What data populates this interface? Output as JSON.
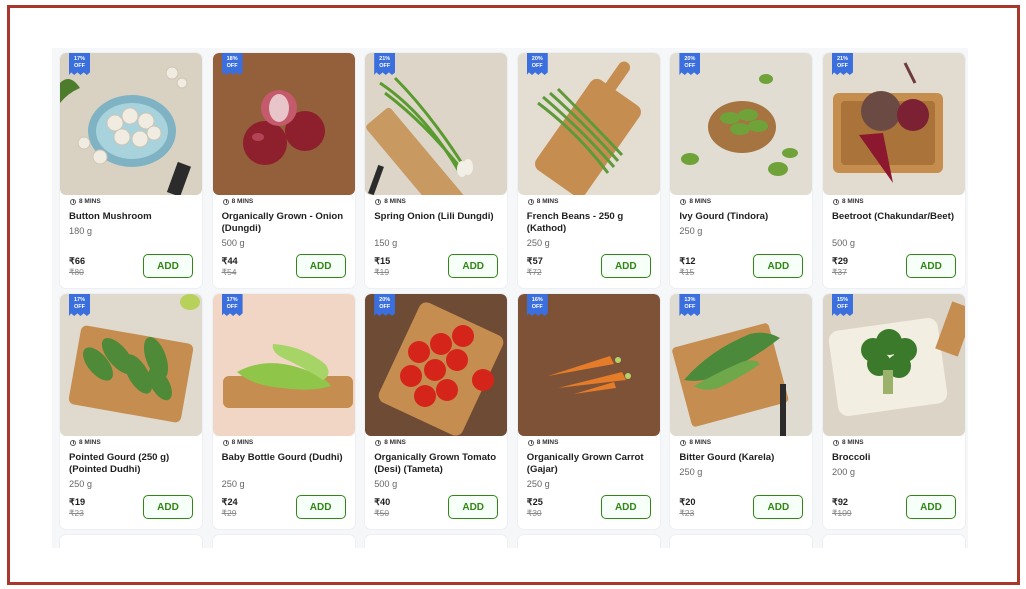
{
  "colors": {
    "frame": "#a9382c",
    "badge": "#3b6fde",
    "add_green": "#318616"
  },
  "add_label": "ADD",
  "eta_icon": "clock-icon",
  "products": [
    {
      "name": "Button Mushroom",
      "qty": "180 g",
      "price": "₹66",
      "mrp": "₹80",
      "eta": "8 MINS",
      "discount_pct": "17%",
      "off": "OFF",
      "bg": "#d9d2c3",
      "art": "mushroom"
    },
    {
      "name": "Organically Grown - Onion (Dungdi)",
      "qty": "500 g",
      "price": "₹44",
      "mrp": "₹54",
      "eta": "8 MINS",
      "discount_pct": "18%",
      "off": "OFF",
      "bg": "#93603b",
      "art": "onion"
    },
    {
      "name": "Spring Onion (Lili Dungdi)",
      "qty": "150 g",
      "price": "₹15",
      "mrp": "₹19",
      "eta": "8 MINS",
      "discount_pct": "21%",
      "off": "OFF",
      "bg": "#ddd6c8",
      "art": "springonion"
    },
    {
      "name": "French Beans - 250 g (Kathod)",
      "qty": "250 g",
      "price": "₹57",
      "mrp": "₹72",
      "eta": "8 MINS",
      "discount_pct": "20%",
      "off": "OFF",
      "bg": "#e3ddd2",
      "art": "beans"
    },
    {
      "name": "Ivy Gourd (Tindora)",
      "qty": "250 g",
      "price": "₹12",
      "mrp": "₹15",
      "eta": "8 MINS",
      "discount_pct": "20%",
      "off": "OFF",
      "bg": "#e2ddd2",
      "art": "ivygourd"
    },
    {
      "name": "Beetroot (Chakundar/Beet)",
      "qty": "500 g",
      "price": "₹29",
      "mrp": "₹37",
      "eta": "8 MINS",
      "discount_pct": "21%",
      "off": "OFF",
      "bg": "#e1dbd0",
      "art": "beetroot"
    },
    {
      "name": "Pointed Gourd (250 g) (Pointed Dudhi)",
      "qty": "250 g",
      "price": "₹19",
      "mrp": "₹23",
      "eta": "8 MINS",
      "discount_pct": "17%",
      "off": "OFF",
      "bg": "#e0dace",
      "art": "pointedgourd"
    },
    {
      "name": "Baby Bottle Gourd (Dudhi)",
      "qty": "250 g",
      "price": "₹24",
      "mrp": "₹29",
      "eta": "8 MINS",
      "discount_pct": "17%",
      "off": "OFF",
      "bg": "#f1d6c6",
      "art": "bottlegourd"
    },
    {
      "name": "Organically Grown Tomato (Desi) (Tameta)",
      "qty": "500 g",
      "price": "₹40",
      "mrp": "₹50",
      "eta": "8 MINS",
      "discount_pct": "20%",
      "off": "OFF",
      "bg": "#6e4b34",
      "art": "tomato"
    },
    {
      "name": "Organically Grown Carrot (Gajar)",
      "qty": "250 g",
      "price": "₹25",
      "mrp": "₹30",
      "eta": "8 MINS",
      "discount_pct": "16%",
      "off": "OFF",
      "bg": "#7d5236",
      "art": "carrot"
    },
    {
      "name": "Bitter Gourd (Karela)",
      "qty": "250 g",
      "price": "₹20",
      "mrp": "₹23",
      "eta": "8 MINS",
      "discount_pct": "13%",
      "off": "OFF",
      "bg": "#e0dbd1",
      "art": "bittergourd"
    },
    {
      "name": "Broccoli",
      "qty": "200 g",
      "price": "₹92",
      "mrp": "₹109",
      "eta": "8 MINS",
      "discount_pct": "15%",
      "off": "OFF",
      "bg": "#dcd4c7",
      "art": "broccoli"
    }
  ]
}
